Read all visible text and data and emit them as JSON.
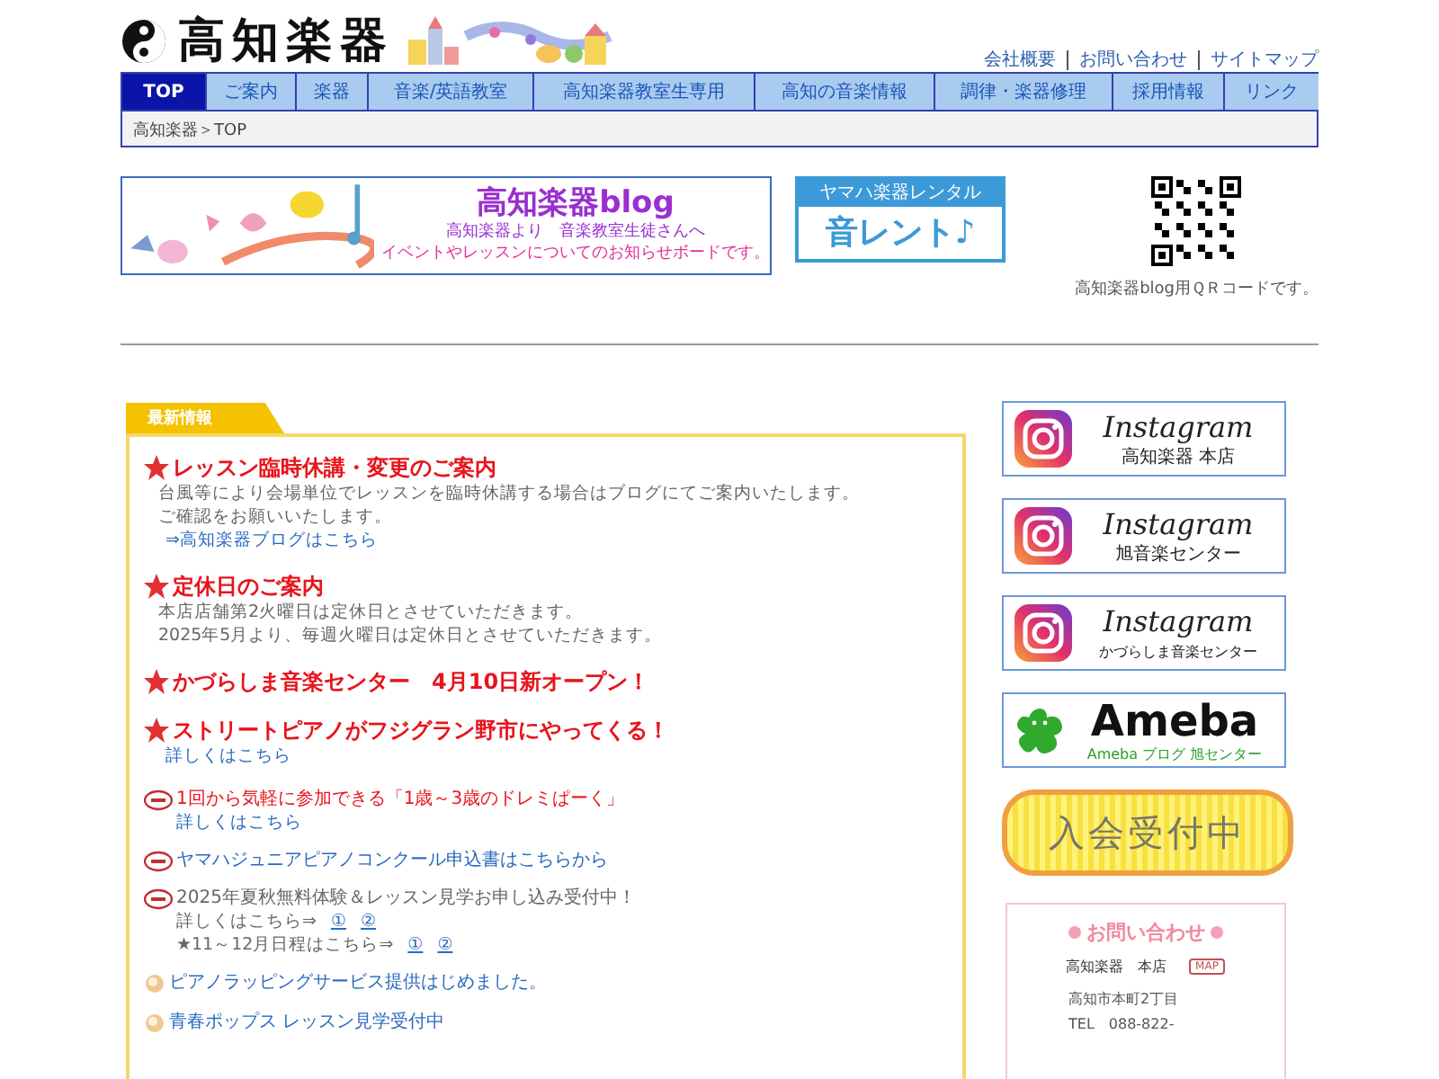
{
  "header": {
    "logo_text": "高知楽器",
    "top_links": [
      "会社概要",
      "お問い合わせ",
      "サイトマップ"
    ]
  },
  "nav": [
    {
      "label": "TOP",
      "selected": true
    },
    {
      "label": "ご案内",
      "selected": false
    },
    {
      "label": "楽器",
      "selected": false
    },
    {
      "label": "音楽/英語教室",
      "selected": false
    },
    {
      "label": "高知楽器教室生専用",
      "selected": false
    },
    {
      "label": "高知の音楽情報",
      "selected": false
    },
    {
      "label": "調律・楽器修理",
      "selected": false
    },
    {
      "label": "採用情報",
      "selected": false
    },
    {
      "label": "リンク",
      "selected": false
    }
  ],
  "breadcrumb": "高知楽器＞TOP",
  "banners": {
    "blog": {
      "title": "高知楽器blog",
      "line_1": "高知楽器より　音楽教室生徒さんへ",
      "line_2": "イベントやレッスンについてのお知らせボードです。"
    },
    "rental": {
      "top": "ヤマハ楽器レンタル",
      "main": "音レント♪"
    },
    "qr_caption": "高知楽器blog用ＱＲコードです。"
  },
  "news": {
    "heading": "最新情報",
    "items": [
      {
        "kind": "star",
        "title": "レッスン臨時休講・変更のご案内",
        "color": "#e8141c",
        "lines": [
          "台風等により会場単位でレッスンを臨時休講する場合はブログにてご案内いたします。",
          "ご確認をお願いいたします。"
        ],
        "link": "⇒高知楽器ブログはこちら"
      },
      {
        "kind": "star",
        "title": "定休日のご案内",
        "color": "#e8141c",
        "lines": [
          "本店店舗第2火曜日は定休日とさせていただきます。",
          "2025年5月より、毎週火曜日は定休日とさせていただきます。"
        ]
      },
      {
        "kind": "star",
        "title": "かづらしま音楽センター　4月10日新オープン！",
        "color": "#e8141c"
      },
      {
        "kind": "star",
        "title": "ストリートピアノがフジグラン野市にやってくる！",
        "color": "#e8141c",
        "link": "詳しくはこちら"
      },
      {
        "kind": "new",
        "title": "1回から気軽に参加できる「1歳～3歳のドレミぱーく」",
        "color": "#e8141c",
        "link": "詳しくはこちら"
      },
      {
        "kind": "new",
        "title": "ヤマハジュニアピアノコンクール申込書はこちらから",
        "color": "#2a6ac0"
      },
      {
        "kind": "new",
        "title": "2025年夏秋無料体験＆レッスン見学お申し込み受付中！",
        "color": "#666666",
        "sublines": [
          {
            "text": "詳しくはこちら⇒",
            "links": [
              "①",
              "②"
            ]
          },
          {
            "text": "★11～12月日程はこちら⇒",
            "links": [
              "①",
              "②"
            ]
          }
        ]
      },
      {
        "kind": "dot",
        "title": "ピアノラッピングサービス提供はじめました。",
        "color": "#2a6ac0"
      },
      {
        "kind": "dot",
        "title": "青春ポップス レッスン見学受付中",
        "color": "#2a6ac0"
      }
    ]
  },
  "sidebar": {
    "cards": [
      {
        "kind": "instagram",
        "brand": "Instagram",
        "caption": "高知楽器 本店"
      },
      {
        "kind": "instagram",
        "brand": "Instagram",
        "caption": "旭音楽センター"
      },
      {
        "kind": "instagram",
        "brand": "Instagram",
        "caption": "かづらしま音楽センター"
      },
      {
        "kind": "ameba",
        "brand": "Ameba",
        "caption": "Ameba ブログ 旭センター"
      },
      {
        "kind": "join",
        "brand": "入会受付中"
      }
    ],
    "contact": {
      "title": "お問い合わせ",
      "store": "高知楽器　本店",
      "map": "MAP",
      "lines": [
        "高知市本町2丁目",
        "TEL　088-822-"
      ]
    }
  }
}
